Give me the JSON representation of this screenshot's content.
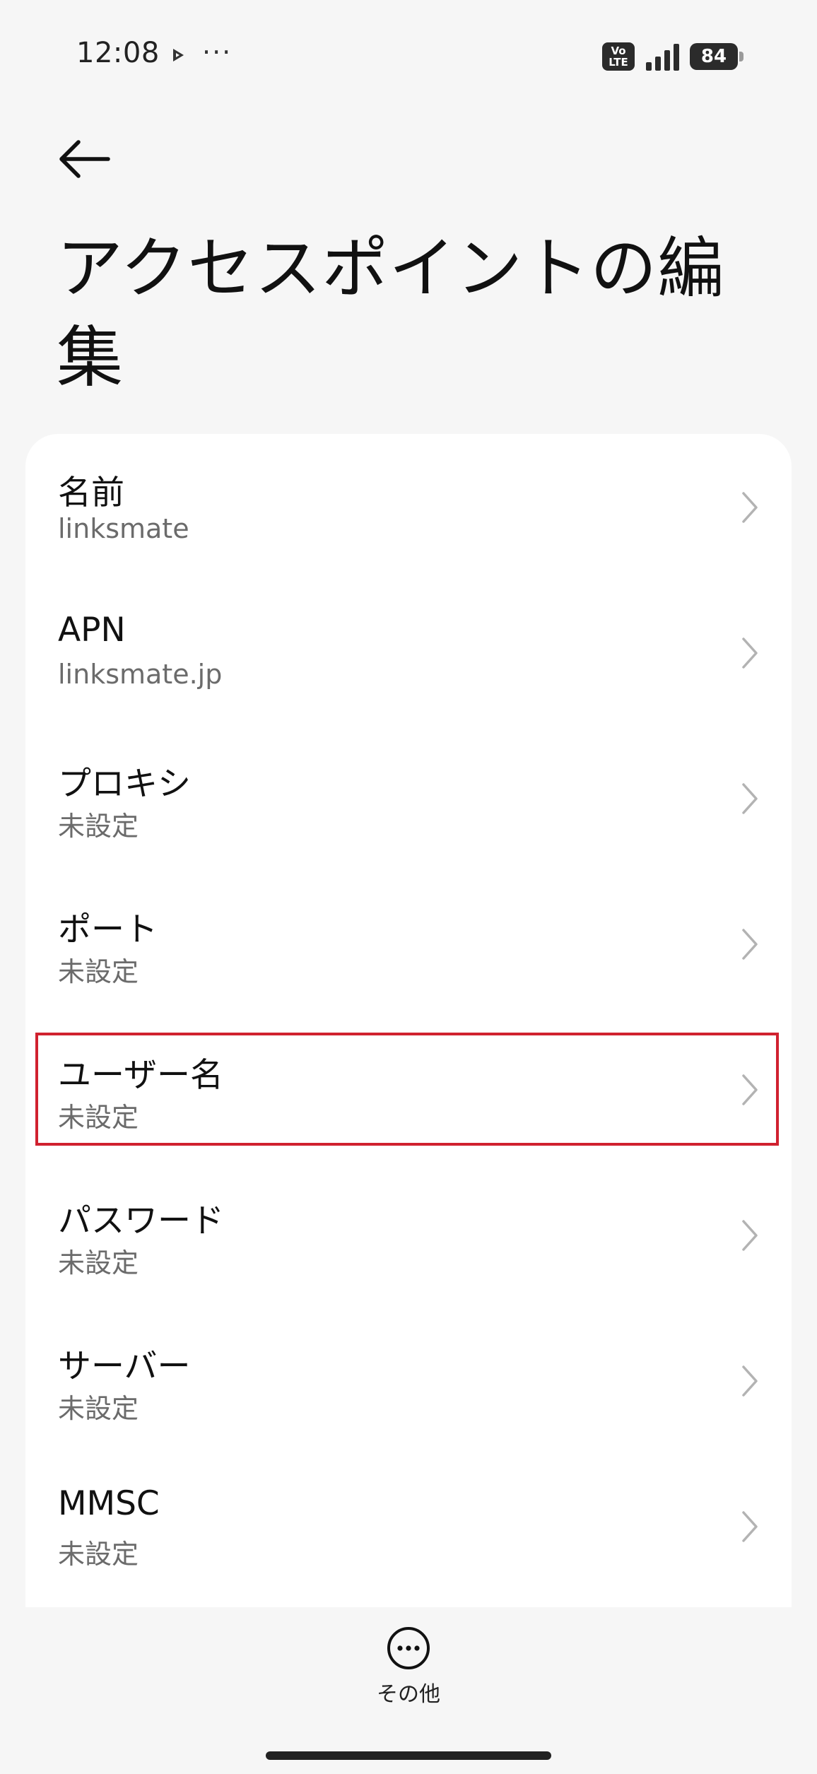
{
  "status_bar": {
    "time": "12:08",
    "more_dots": "···",
    "volte_top": "Vo",
    "volte_bottom": "LTE",
    "battery_level": "84"
  },
  "header": {
    "title": "アクセスポイントの編集"
  },
  "settings": [
    {
      "label": "名前",
      "value": "linksmate"
    },
    {
      "label": "APN",
      "value": "linksmate.jp"
    },
    {
      "label": "プロキシ",
      "value": "未設定"
    },
    {
      "label": "ポート",
      "value": "未設定"
    },
    {
      "label": "ユーザー名",
      "value": "未設定",
      "highlighted": true
    },
    {
      "label": "パスワード",
      "value": "未設定"
    },
    {
      "label": "サーバー",
      "value": "未設定"
    },
    {
      "label": "MMSC",
      "value": "未設定"
    }
  ],
  "bottom_action": {
    "label": "その他",
    "icon": "more-circle-icon"
  },
  "colors": {
    "background": "#f6f6f6",
    "card": "#ffffff",
    "highlight_border": "#d0212f",
    "secondary_text": "#6b6b6b"
  }
}
